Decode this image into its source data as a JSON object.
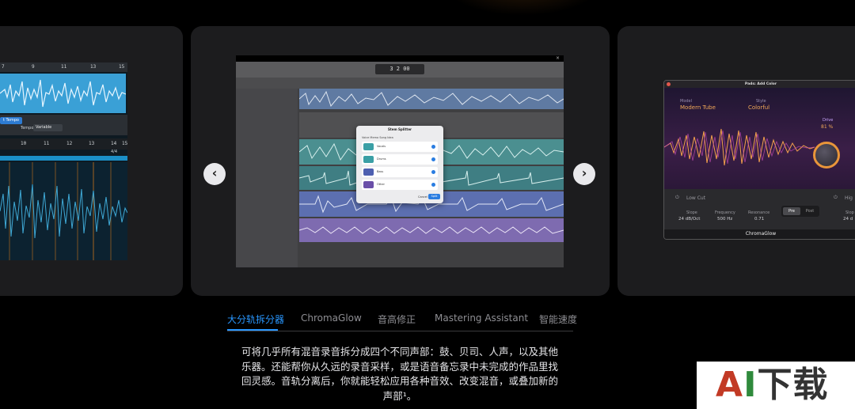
{
  "left_card": {
    "ruler_ticks": [
      "7",
      "9",
      "11",
      "13",
      "15"
    ],
    "chip_label": "t Tempo",
    "tempo_label": "Tempo",
    "tempo_value": "Variable",
    "ruler2_ticks": [
      "10",
      "11",
      "12",
      "13",
      "14",
      "15"
    ],
    "time_sig": "4/4"
  },
  "center_card": {
    "lcd_text": "3 2   00",
    "dialog": {
      "title": "Stem Splitter",
      "subtitle": "Voice Memo Song Idea",
      "rows": [
        {
          "label": "Vocals",
          "color": "#3a9fa5"
        },
        {
          "label": "Drums",
          "color": "#3a9fa5"
        },
        {
          "label": "Bass",
          "color": "#4d5fb0"
        },
        {
          "label": "Other",
          "color": "#6a4fa8"
        }
      ],
      "cancel": "Cancel",
      "split": "Split"
    }
  },
  "right_card": {
    "window_title": "Pads: Add Color",
    "model_label": "Model",
    "model_value": "Modern Tube",
    "style_label": "Style",
    "style_value": "Colorful",
    "drive_label": "Drive",
    "drive_value": "81 %",
    "lowcut_label": "Low Cut",
    "high_label": "Hig",
    "slope_label": "Slope",
    "slope_value": "24 dB/Oct",
    "freq_label": "Frequency",
    "freq_value": "500 Hz",
    "res_label": "Resonance",
    "res_value": "0.71",
    "pre": "Pre",
    "post": "Post",
    "slope_right": "Slop",
    "slope_right_val": "24 d",
    "footer": "ChromaGlow"
  },
  "nav": {
    "prev_glyph": "‹",
    "next_glyph": "›"
  },
  "tabs": [
    "大分轨拆分器",
    "ChromaGlow",
    "音高修正",
    "Mastering Assistant",
    "智能速度"
  ],
  "description": "可将几乎所有混音录音拆分成四个不同声部：鼓、贝司、人声，以及其他乐器。还能帮你从久远的录音采样，或是语音备忘录中未完成的作品里找回灵感。音轨分离后，你就能轻松应用各种音效、改变混音，或叠加新的声部¹。",
  "watermark": "AI下载",
  "colors": {
    "accent": "#2997ff",
    "card": "#1c1c1e",
    "background": "#000000"
  }
}
